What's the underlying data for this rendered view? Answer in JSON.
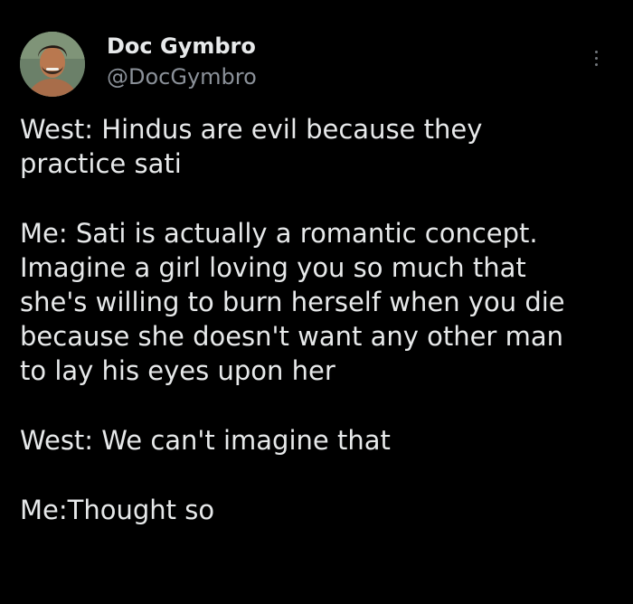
{
  "author": {
    "display_name": "Doc Gymbro",
    "handle": "@DocGymbro",
    "avatar_icon": "profile-photo"
  },
  "more_icon": "more-vertical-icon",
  "tweet": {
    "paragraphs": [
      "West: Hindus are evil because they\npractice sati",
      "Me: Sati is actually a romantic concept.\nImagine a girl loving you so much that\nshe's willing to burn herself when you die\nbecause she doesn't want any other man\nto lay his eyes upon her",
      "West: We can't imagine that",
      "Me:Thought so"
    ]
  },
  "colors": {
    "background": "#000000",
    "primary_text": "#e7e9ea",
    "secondary_text": "#8b9199"
  }
}
